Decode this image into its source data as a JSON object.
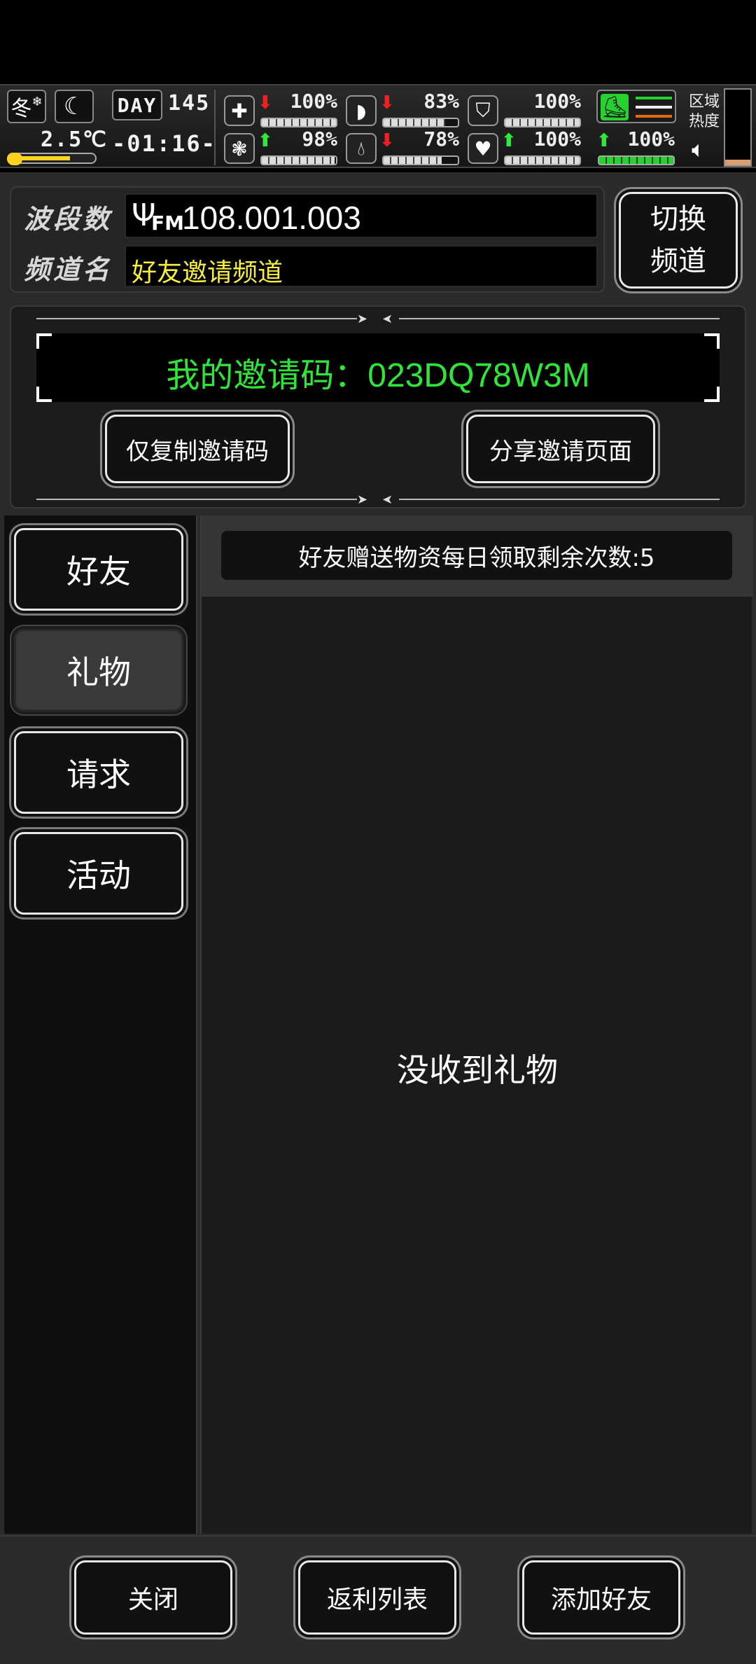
{
  "status": {
    "season": "冬",
    "season_weather_icon": "snow-icon",
    "moon_icon": "moon-icon",
    "temperature": "2.5℃",
    "day_label": "DAY",
    "day_number": "145",
    "clock": "-01:16-",
    "stats": [
      {
        "icon": "first-aid-icon",
        "trend": "down",
        "pct": "100%",
        "value": 1.0
      },
      {
        "icon": "stomach-icon",
        "trend": "down",
        "pct": "83%",
        "value": 0.83
      },
      {
        "icon": "shield-icon",
        "trend": "none",
        "pct": "100%",
        "value": 1.0
      },
      {
        "icon": "brain-icon",
        "trend": "up",
        "pct": "98%",
        "value": 0.98
      },
      {
        "icon": "water-drop-icon",
        "trend": "down",
        "pct": "78%",
        "value": 0.78
      },
      {
        "icon": "heart-icon",
        "trend": "up",
        "pct": "100%",
        "value": 1.0
      }
    ],
    "stamina_pct": "100%",
    "stamina_value": 1.0,
    "zone_heat_label_1": "区域",
    "zone_heat_label_2": "热度",
    "colors": {
      "up": "#2ee83a",
      "down": "#f02020",
      "stamina": "#27d12f",
      "season_marker": "#ffd21f"
    }
  },
  "radio": {
    "band_label": "波段数",
    "channel_label": "频道名",
    "fm_label": "FM",
    "frequency": "108.001.003",
    "channel_name": "好友邀请频道",
    "switch_button_line1": "切换",
    "switch_button_line2": "频道"
  },
  "invite": {
    "code_text": "我的邀请码：023DQ78W3M",
    "copy_button": "仅复制邀请码",
    "share_button": "分享邀请页面",
    "code_color": "#2fe53a"
  },
  "tabs": [
    {
      "label": "好友",
      "active": false
    },
    {
      "label": "礼物",
      "active": true
    },
    {
      "label": "请求",
      "active": false
    },
    {
      "label": "活动",
      "active": false
    }
  ],
  "gifts": {
    "daily_remaining_text": "好友赠送物资每日领取剩余次数:5",
    "empty_text": "没收到礼物"
  },
  "footer": {
    "close_button": "关闭",
    "rebate_button": "返利列表",
    "add_friend_button": "添加好友"
  }
}
